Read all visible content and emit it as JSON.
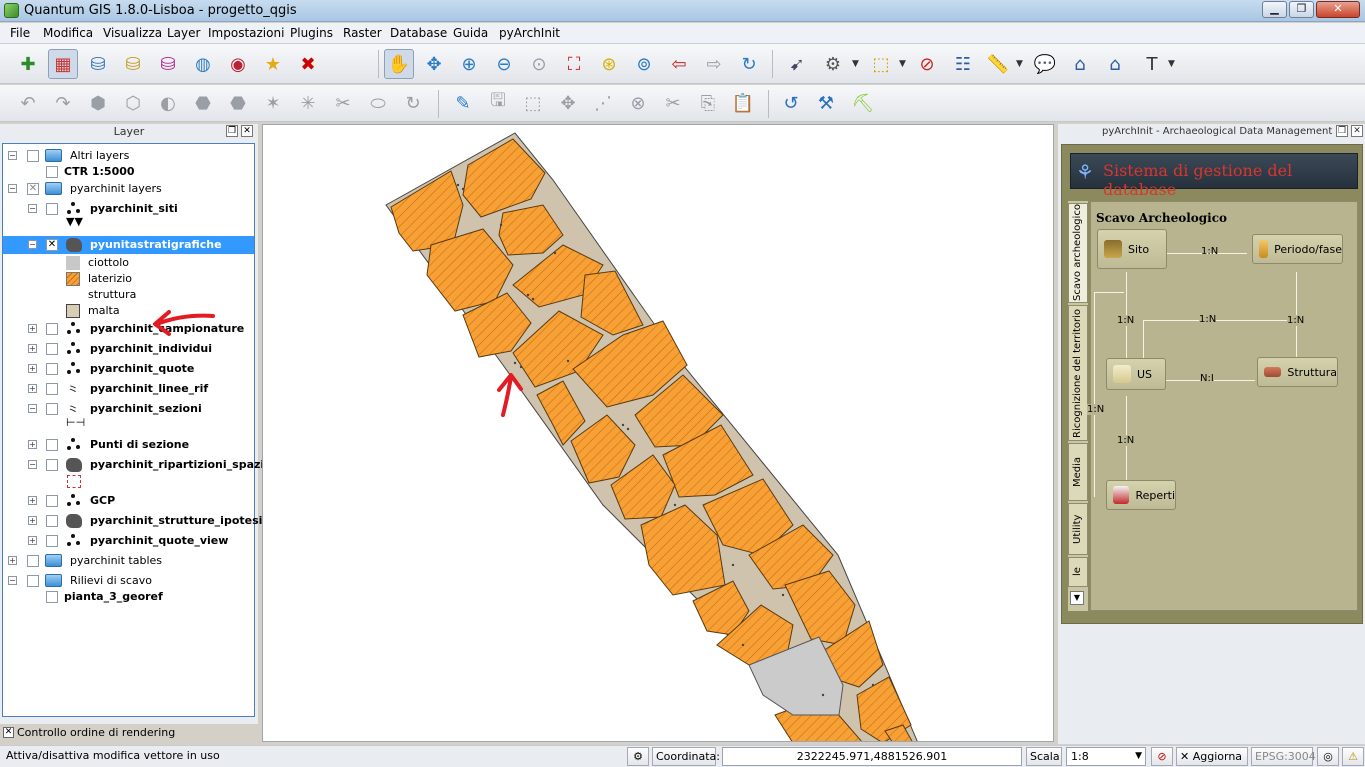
{
  "window": {
    "title": "Quantum GIS 1.8.0-Lisboa - progetto_qgis",
    "min": "▁",
    "max": "❐",
    "close": "✕"
  },
  "menu": [
    "File",
    "Modifica",
    "Visualizza",
    "Layer",
    "Impostazioni",
    "Plugins",
    "Raster",
    "Database",
    "Guida",
    "pyArchInit"
  ],
  "layers_panel": {
    "title": "Layer",
    "float_btn": "❐",
    "close_btn": "✕",
    "rows": {
      "altri_layers": "Altri layers",
      "ctr": "CTR 1:5000",
      "pyarchinit_layers": "pyarchinit layers",
      "siti": "pyarchinit_siti",
      "pyunita": "pyunitastratigrafiche",
      "ciottolo": "ciottolo",
      "laterizio": "laterizio",
      "struttura": "struttura",
      "malta": "malta",
      "campionature": "pyarchinit_campionature",
      "individui": "pyarchinit_individui",
      "quote": "pyarchinit_quote",
      "linee_rif": "pyarchinit_linee_rif",
      "sezioni": "pyarchinit_sezioni",
      "punti_sezione": "Punti di sezione",
      "ripartizioni": "pyarchinit_ripartizioni_spaziali",
      "gcp": "GCP",
      "strutture_ipotesi": "pyarchinit_strutture_ipotesi",
      "quote_view": "pyarchinit_quote_view",
      "tables": "pyarchinit tables",
      "rilievi": "Rilievi di scavo",
      "pianta": "pianta_3_georef"
    },
    "render_order": "Controllo ordine di rendering"
  },
  "legend_colors": {
    "ciottolo": "#c8c8c8",
    "laterizio": "#f7a035",
    "malta": "#d9cdb4",
    "selection": "#3399ff"
  },
  "right_panel": {
    "title": "pyArchInit - Archaeological Data Management",
    "banner": "Sistema di gestione del database",
    "tabs": [
      "Scavo archeologico",
      "Ricognizione del territorio",
      "Media",
      "Utility",
      "le"
    ],
    "section": "Scavo Archeologico",
    "nodes": {
      "sito": "Sito",
      "periodo": "Periodo/fase",
      "us": "US",
      "struttura": "Struttura",
      "reperti": "Reperti"
    },
    "rels": {
      "sito_periodo": "1:N",
      "sito_us": "1:N",
      "us_periodo_mid": "1:N",
      "periodo_down": "1:N",
      "us_struttura": "N:I",
      "left": "1:N",
      "us_reperti": "1:N"
    }
  },
  "status": {
    "message": "Attiva/disattiva modifica vettore in uso",
    "coord_label": "Coordinata:",
    "coord_value": "2322245.971,4881526.901",
    "scale_label": "Scala",
    "scale_value": "1:8",
    "render_label": "Aggiorna",
    "epsg": "EPSG:3004"
  },
  "map_colors": {
    "mortar": "#cfc3ae",
    "brick": "#f7a035",
    "stone": "#cbcbcb",
    "arrow": "#e31b23"
  }
}
